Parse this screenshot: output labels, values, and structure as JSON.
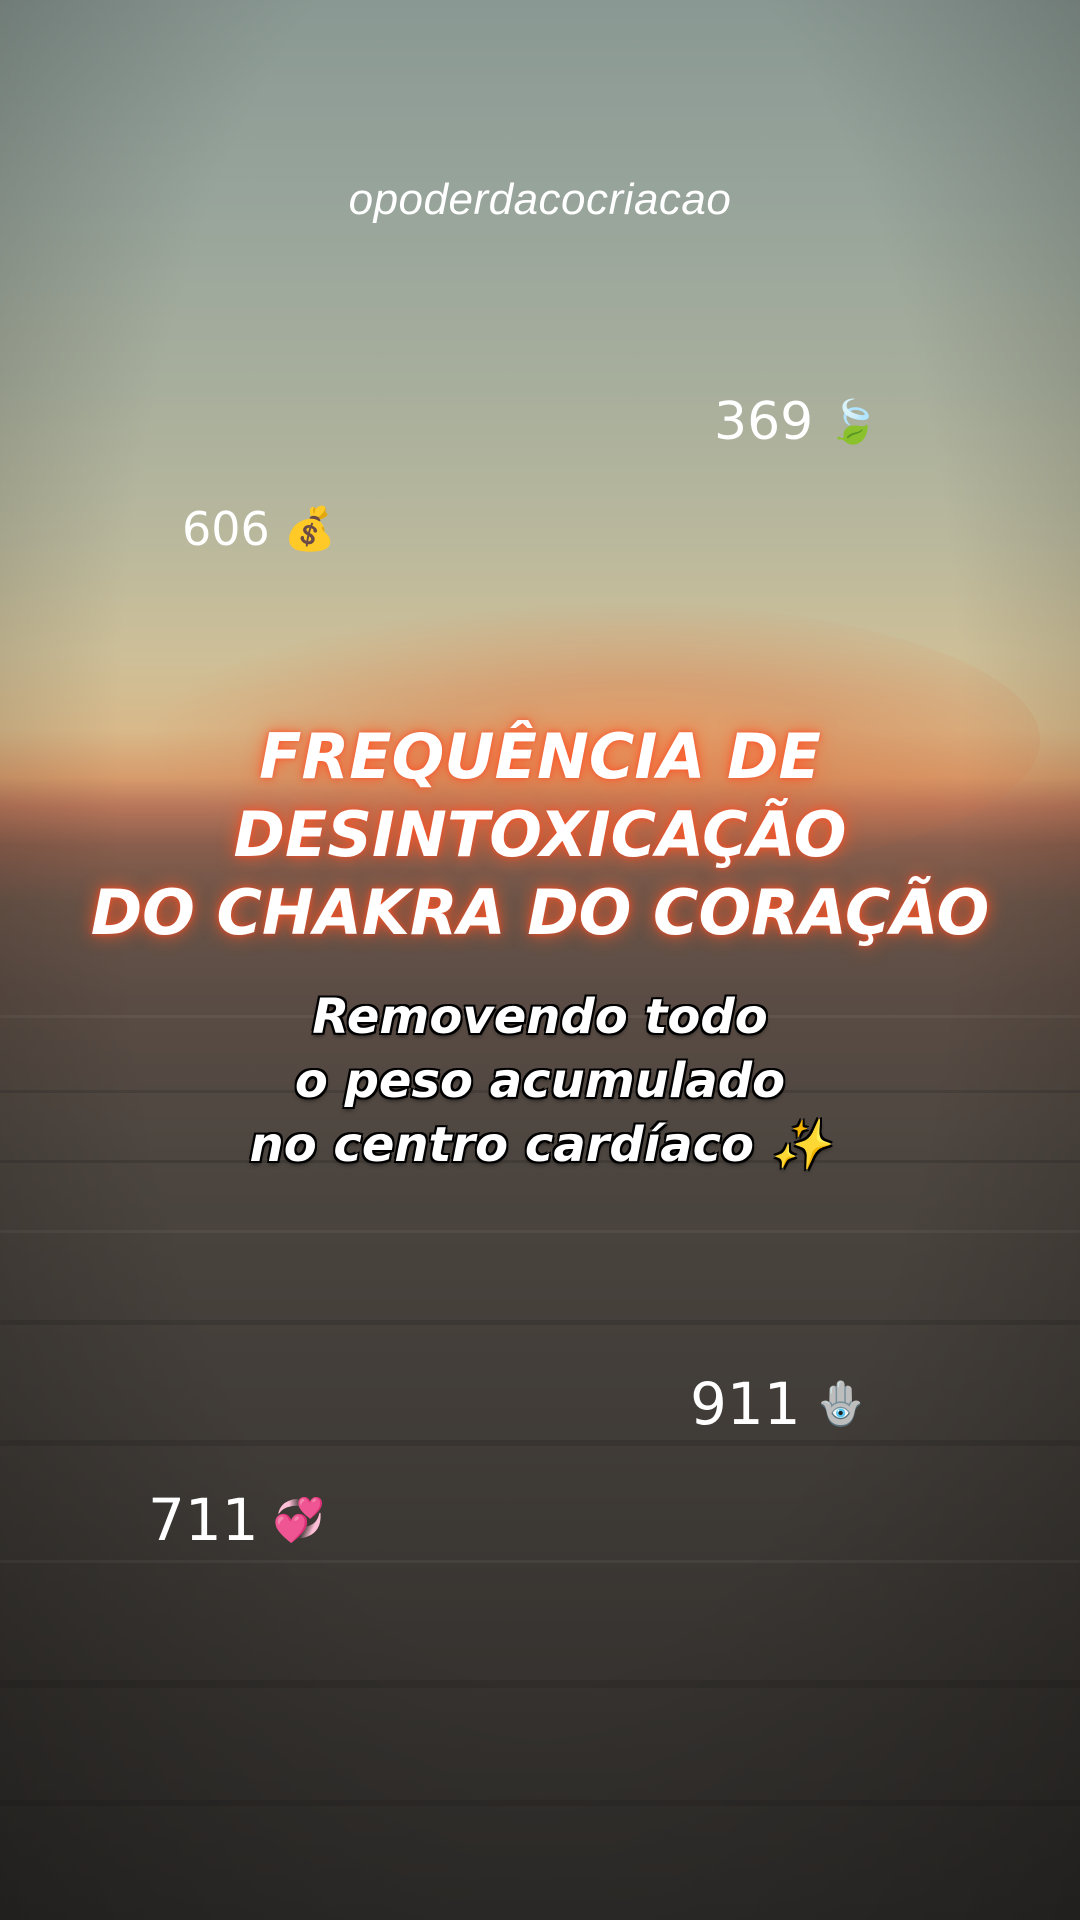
{
  "handle": "opoderdacocriacao",
  "numbers": [
    {
      "value": "369",
      "emoji": "🍃",
      "icon": "leaves-icon"
    },
    {
      "value": "606",
      "emoji": "💰",
      "icon": "money-bag-icon"
    },
    {
      "value": "911",
      "emoji": "🪬",
      "icon": "hamsa-icon"
    },
    {
      "value": "711",
      "emoji": "💞",
      "icon": "revolving-hearts-icon"
    }
  ],
  "title": {
    "lines": [
      "FREQUÊNCIA DE",
      "DESINTOXICAÇÃO",
      "DO CHAKRA DO CORAÇÃO"
    ]
  },
  "subtitle": {
    "lines": [
      "Removendo todo",
      "o peso acumulado",
      "no centro cardíaco ✨"
    ]
  }
}
